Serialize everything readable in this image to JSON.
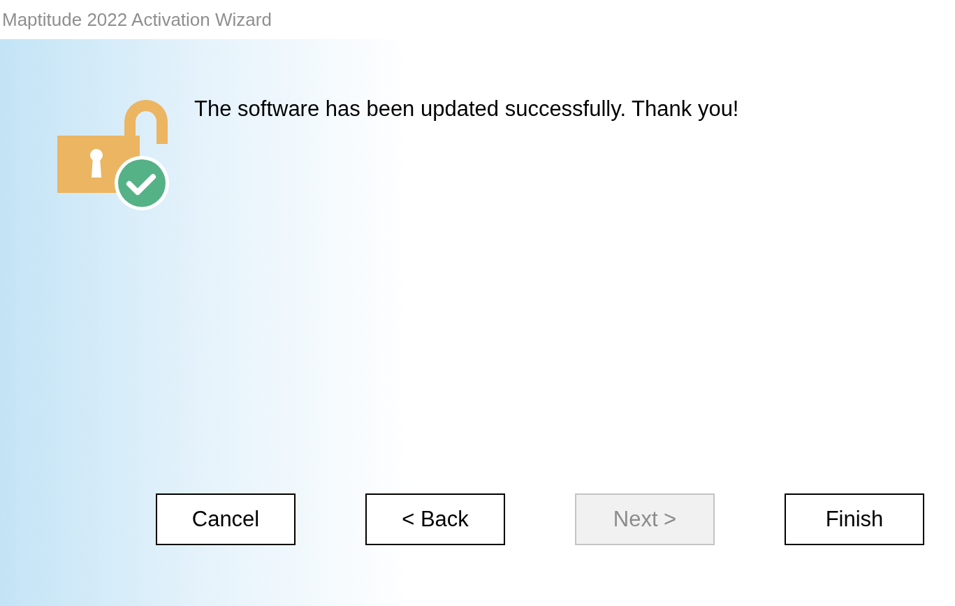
{
  "window": {
    "title": "Maptitude 2022 Activation Wizard"
  },
  "message": "The software has been updated successfully. Thank you!",
  "buttons": [
    {
      "label": "Cancel",
      "disabled": false
    },
    {
      "label": "< Back",
      "disabled": false
    },
    {
      "label": "Next >",
      "disabled": true
    },
    {
      "label": "Finish",
      "disabled": false
    }
  ]
}
